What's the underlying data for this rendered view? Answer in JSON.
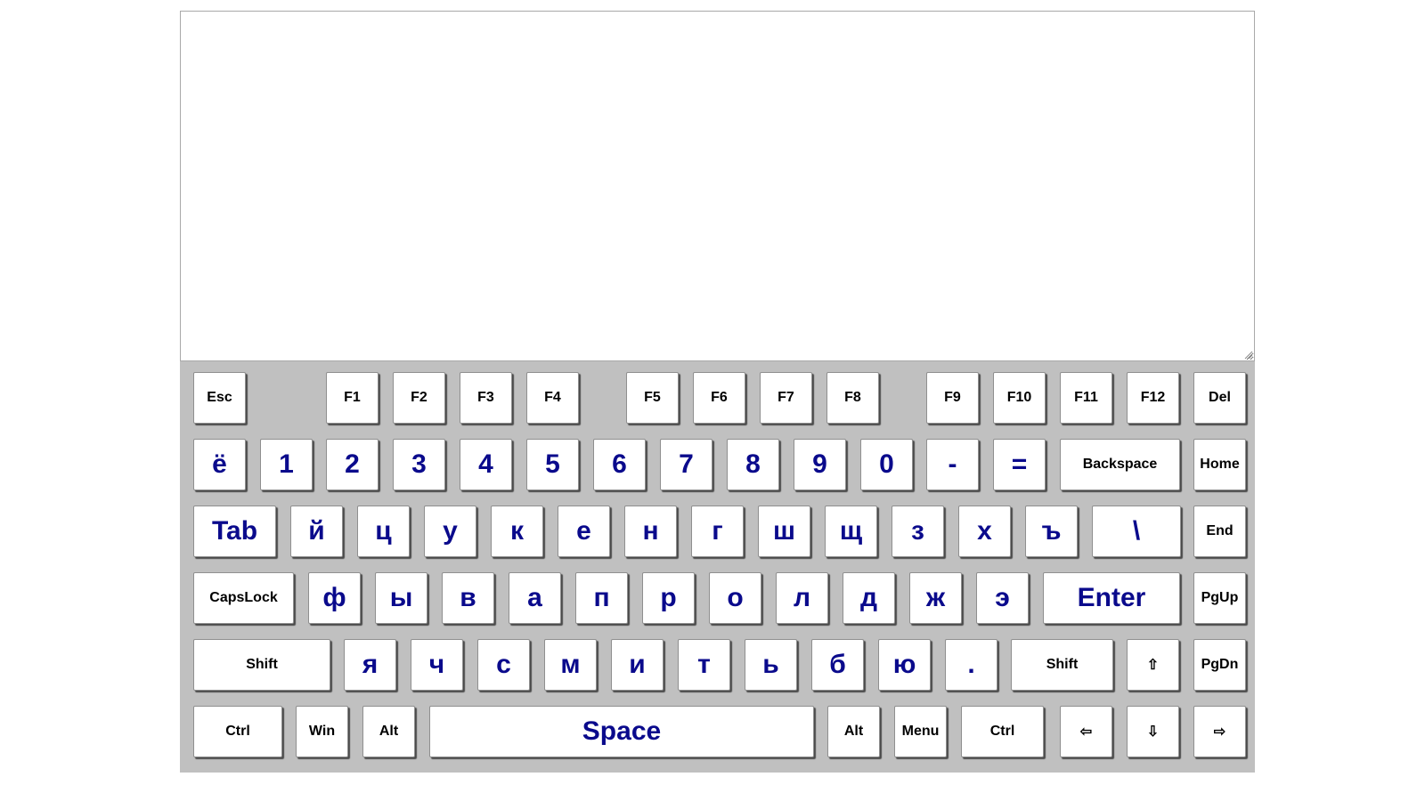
{
  "editor": {
    "value": ""
  },
  "keyboard": {
    "text_color": "#0a0a8c",
    "background": "#c0c0c0",
    "rows": [
      {
        "name": "function-row",
        "keys": [
          {
            "label": "Esc",
            "type": "fn"
          },
          {
            "label": "F1",
            "type": "fn"
          },
          {
            "label": "F2",
            "type": "fn"
          },
          {
            "label": "F3",
            "type": "fn"
          },
          {
            "label": "F4",
            "type": "fn"
          },
          {
            "label": "F5",
            "type": "fn"
          },
          {
            "label": "F6",
            "type": "fn"
          },
          {
            "label": "F7",
            "type": "fn"
          },
          {
            "label": "F8",
            "type": "fn"
          },
          {
            "label": "F9",
            "type": "fn"
          },
          {
            "label": "F10",
            "type": "fn"
          },
          {
            "label": "F11",
            "type": "fn"
          },
          {
            "label": "F12",
            "type": "fn"
          },
          {
            "label": "Del",
            "type": "fn"
          }
        ]
      },
      {
        "name": "number-row",
        "keys": [
          {
            "label": "ё",
            "type": "ch"
          },
          {
            "label": "1",
            "type": "ch"
          },
          {
            "label": "2",
            "type": "ch"
          },
          {
            "label": "3",
            "type": "ch"
          },
          {
            "label": "4",
            "type": "ch"
          },
          {
            "label": "5",
            "type": "ch"
          },
          {
            "label": "6",
            "type": "ch"
          },
          {
            "label": "7",
            "type": "ch"
          },
          {
            "label": "8",
            "type": "ch"
          },
          {
            "label": "9",
            "type": "ch"
          },
          {
            "label": "0",
            "type": "ch"
          },
          {
            "label": "-",
            "type": "ch"
          },
          {
            "label": "=",
            "type": "ch"
          },
          {
            "label": "Backspace",
            "type": "fn"
          },
          {
            "label": "Home",
            "type": "fn"
          }
        ]
      },
      {
        "name": "top-letter-row",
        "keys": [
          {
            "label": "Tab",
            "type": "big"
          },
          {
            "label": "й",
            "type": "ch"
          },
          {
            "label": "ц",
            "type": "ch"
          },
          {
            "label": "у",
            "type": "ch"
          },
          {
            "label": "к",
            "type": "ch"
          },
          {
            "label": "е",
            "type": "ch"
          },
          {
            "label": "н",
            "type": "ch"
          },
          {
            "label": "г",
            "type": "ch"
          },
          {
            "label": "ш",
            "type": "ch"
          },
          {
            "label": "щ",
            "type": "ch"
          },
          {
            "label": "з",
            "type": "ch"
          },
          {
            "label": "х",
            "type": "ch"
          },
          {
            "label": "ъ",
            "type": "ch"
          },
          {
            "label": "\\",
            "type": "ch"
          },
          {
            "label": "End",
            "type": "fn"
          }
        ]
      },
      {
        "name": "home-row",
        "keys": [
          {
            "label": "CapsLock",
            "type": "fn"
          },
          {
            "label": "ф",
            "type": "ch"
          },
          {
            "label": "ы",
            "type": "ch"
          },
          {
            "label": "в",
            "type": "ch"
          },
          {
            "label": "а",
            "type": "ch"
          },
          {
            "label": "п",
            "type": "ch"
          },
          {
            "label": "р",
            "type": "ch"
          },
          {
            "label": "о",
            "type": "ch"
          },
          {
            "label": "л",
            "type": "ch"
          },
          {
            "label": "д",
            "type": "ch"
          },
          {
            "label": "ж",
            "type": "ch"
          },
          {
            "label": "э",
            "type": "ch"
          },
          {
            "label": "Enter",
            "type": "big"
          },
          {
            "label": "PgUp",
            "type": "fn"
          }
        ]
      },
      {
        "name": "bottom-letter-row",
        "keys": [
          {
            "label": "Shift",
            "type": "fn"
          },
          {
            "label": "я",
            "type": "ch"
          },
          {
            "label": "ч",
            "type": "ch"
          },
          {
            "label": "с",
            "type": "ch"
          },
          {
            "label": "м",
            "type": "ch"
          },
          {
            "label": "и",
            "type": "ch"
          },
          {
            "label": "т",
            "type": "ch"
          },
          {
            "label": "ь",
            "type": "ch"
          },
          {
            "label": "б",
            "type": "ch"
          },
          {
            "label": "ю",
            "type": "ch"
          },
          {
            "label": ".",
            "type": "ch"
          },
          {
            "label": "Shift",
            "type": "fn"
          },
          {
            "label": "⇧",
            "type": "fn"
          },
          {
            "label": "PgDn",
            "type": "fn"
          }
        ]
      },
      {
        "name": "modifier-row",
        "keys": [
          {
            "label": "Ctrl",
            "type": "fn"
          },
          {
            "label": "Win",
            "type": "fn"
          },
          {
            "label": "Alt",
            "type": "fn"
          },
          {
            "label": "Space",
            "type": "big"
          },
          {
            "label": "Alt",
            "type": "fn"
          },
          {
            "label": "Menu",
            "type": "fn"
          },
          {
            "label": "Ctrl",
            "type": "fn"
          },
          {
            "label": "⇦",
            "type": "fn"
          },
          {
            "label": "⇩",
            "type": "fn"
          },
          {
            "label": "⇨",
            "type": "fn"
          }
        ]
      }
    ]
  }
}
